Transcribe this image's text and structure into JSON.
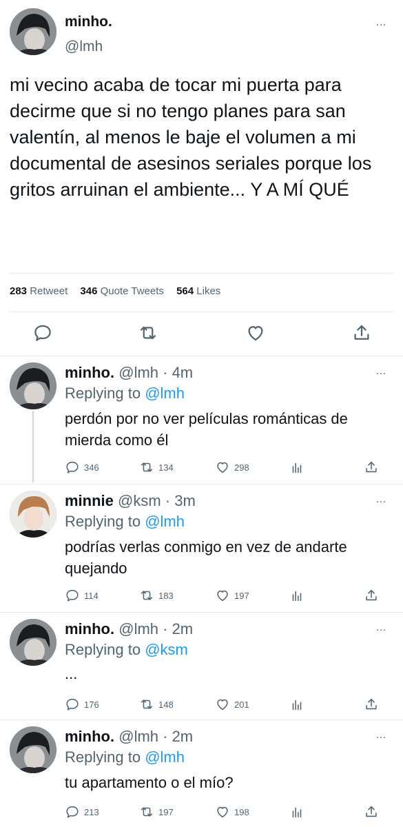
{
  "main": {
    "name": "minho.",
    "handle": "@lmh",
    "text": "mi vecino acaba de tocar mi puerta para decirme que si no tengo planes para san valentín, al menos le baje el volumen a mi documental de asesinos seriales porque los gritos arruinan el ambiente... Y A MÍ QUÉ",
    "stats": {
      "retweets_count": "283",
      "retweets_label": "Retweet",
      "quotes_count": "346",
      "quotes_label": "Quote Tweets",
      "likes_count": "564",
      "likes_label": "Likes"
    },
    "more_icon": "…"
  },
  "replies": [
    {
      "name": "minho.",
      "handle": "@lmh · 4m",
      "replying_label": "Replying to",
      "replying_to": "@lmh",
      "text": "perdón por no ver películas románticas de mierda como él",
      "replies": "346",
      "retweets": "134",
      "likes": "298"
    },
    {
      "name": "minnie",
      "handle": "@ksm · 3m",
      "replying_label": "Replying to",
      "replying_to": "@lmh",
      "text": "podrías verlas conmigo en vez de andarte quejando",
      "replies": "114",
      "retweets": "183",
      "likes": "197"
    },
    {
      "name": "minho.",
      "handle": "@lmh · 2m",
      "replying_label": "Replying to",
      "replying_to": "@ksm",
      "text": "...",
      "replies": "176",
      "retweets": "148",
      "likes": "201"
    },
    {
      "name": "minho.",
      "handle": "@lmh · 2m",
      "replying_label": "Replying to",
      "replying_to": "@lmh",
      "text": "tu apartamento o el mío?",
      "replies": "213",
      "retweets": "197",
      "likes": "198"
    }
  ],
  "colors": {
    "link": "#1d9bf0",
    "muted": "#536471",
    "text": "#0f1419"
  },
  "icons": [
    "reply-icon",
    "retweet-icon",
    "like-icon",
    "share-icon",
    "analytics-icon",
    "more-icon"
  ]
}
